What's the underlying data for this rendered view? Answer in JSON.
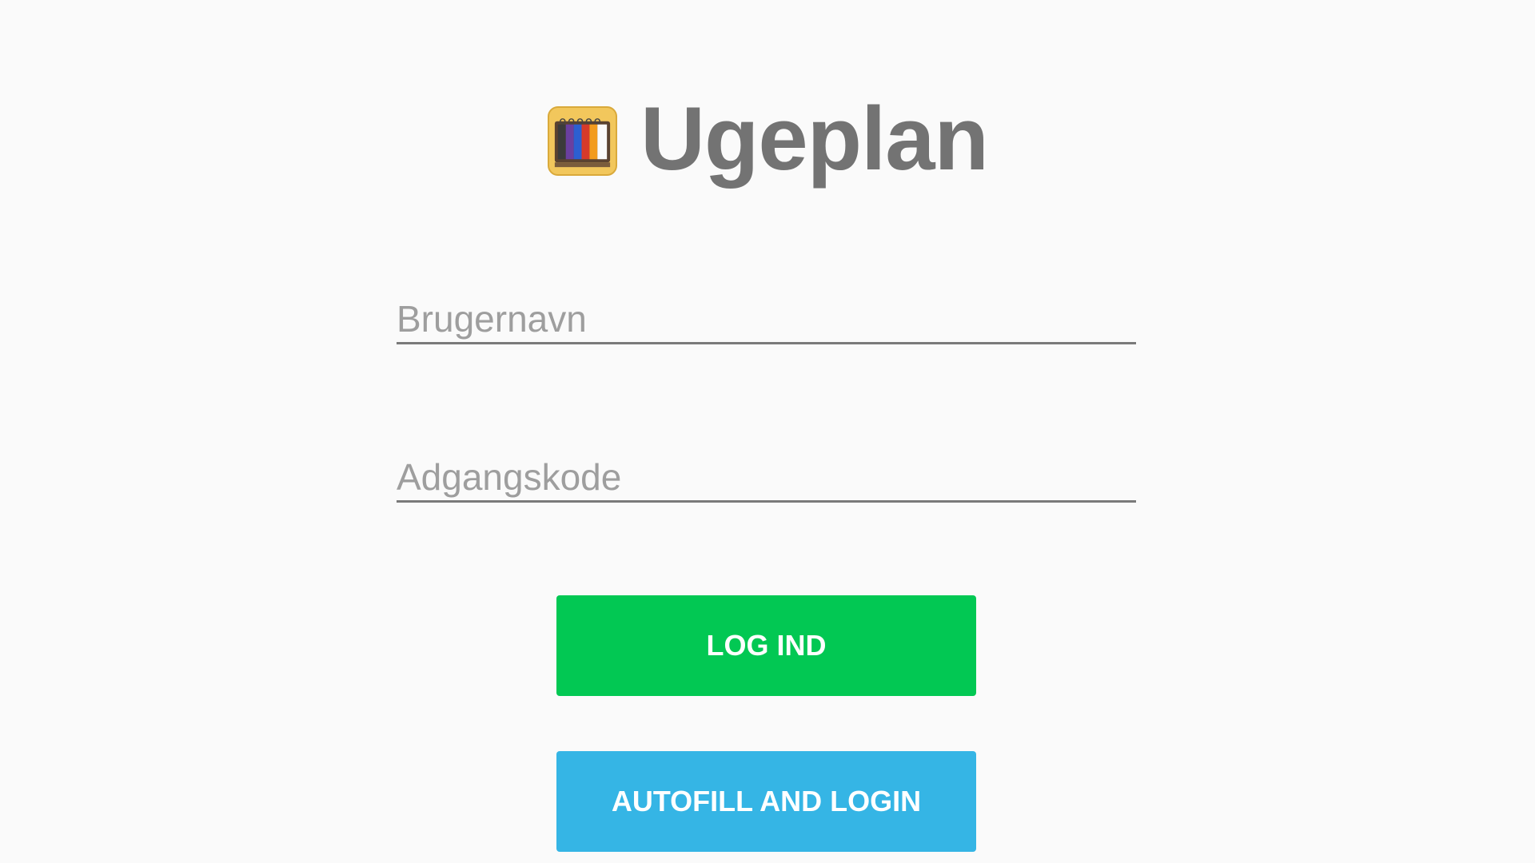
{
  "app": {
    "title": "Ugeplan",
    "logo_icon": "calendar-icon"
  },
  "form": {
    "username_placeholder": "Brugernavn",
    "username_value": "",
    "password_placeholder": "Adgangskode",
    "password_value": ""
  },
  "buttons": {
    "login_label": "LOG IND",
    "autofill_label": "AUTOFILL AND LOGIN"
  },
  "colors": {
    "background": "#fafafa",
    "title_text": "#737373",
    "login_button": "#02c853",
    "autofill_button": "#35b5e5",
    "logo_frame": "#f2c75c"
  }
}
